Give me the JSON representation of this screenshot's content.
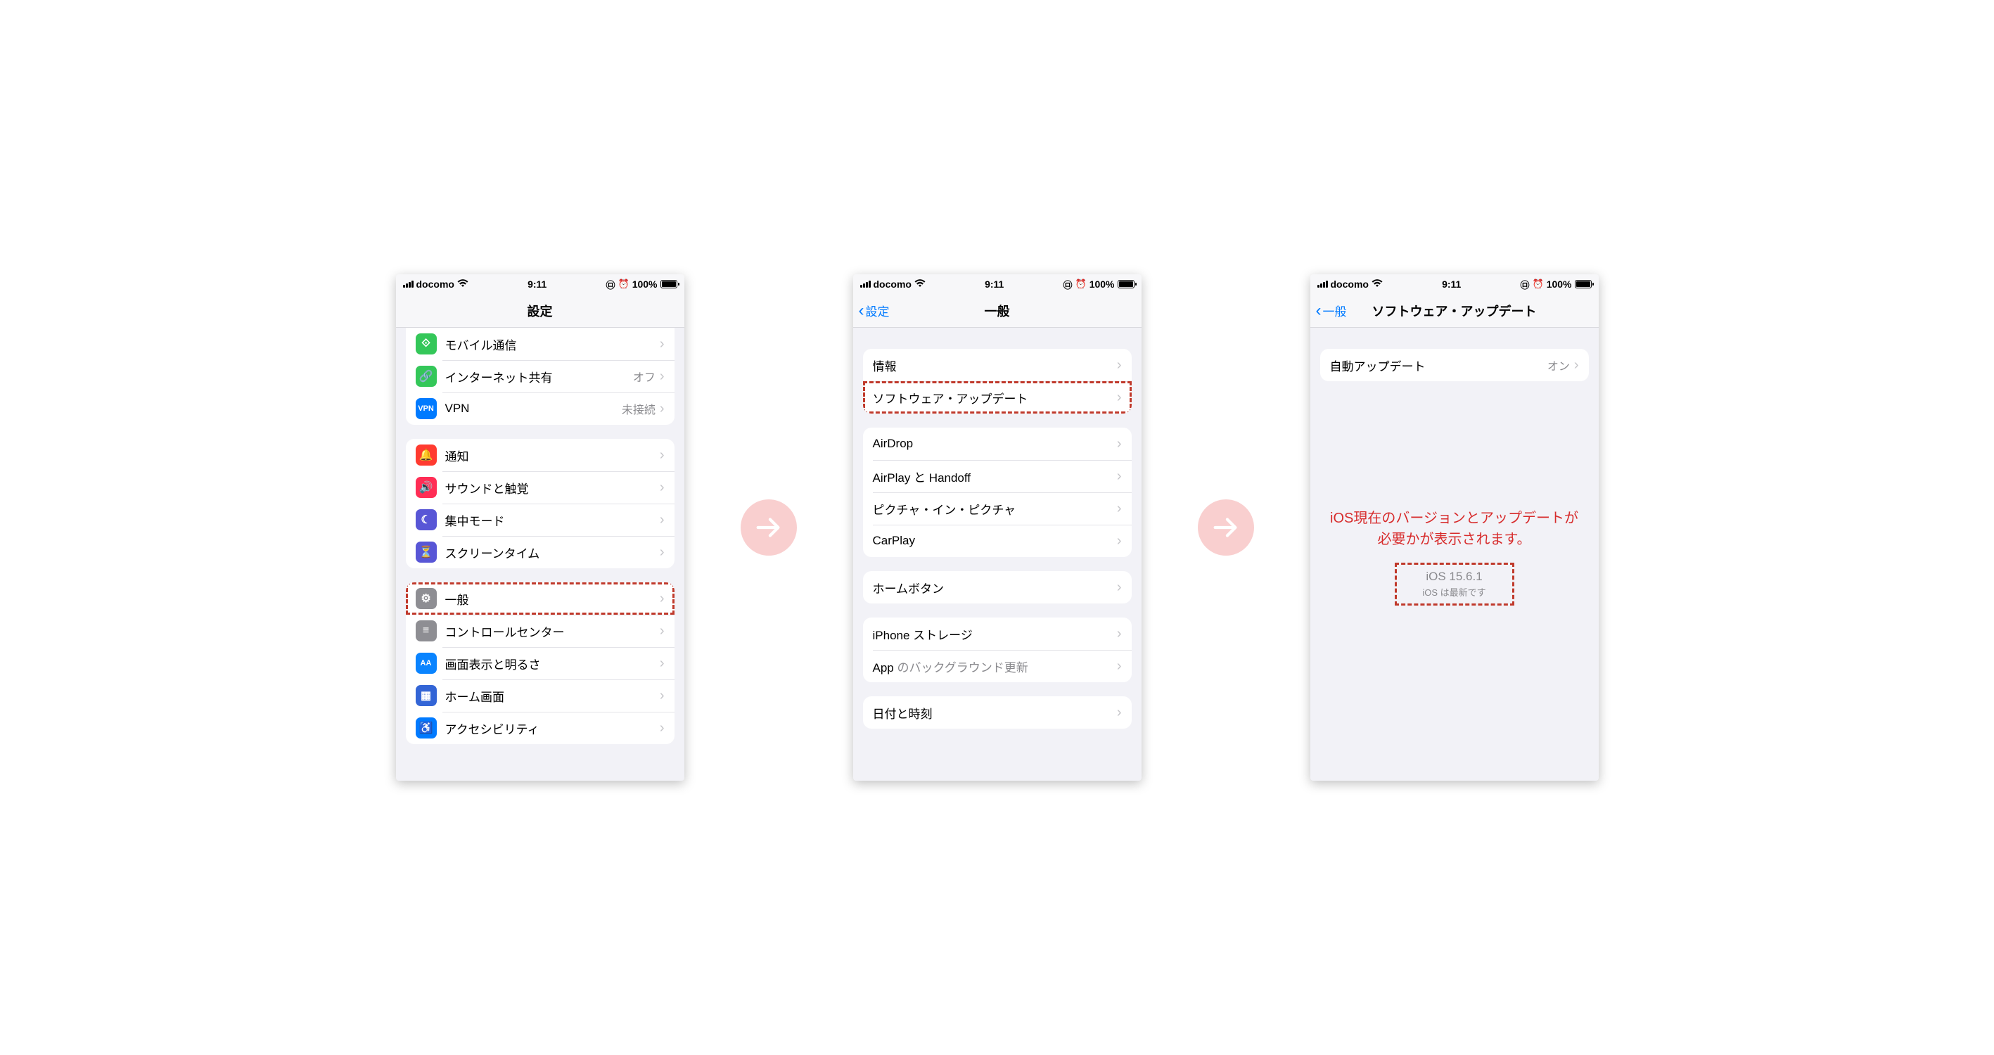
{
  "status": {
    "carrier": "docomo",
    "time": "9:11",
    "battery_pct": "100%"
  },
  "screen1": {
    "title": "設定",
    "rows_a": [
      {
        "label": "モバイル通信",
        "value": "",
        "icon": "antenna-icon",
        "bg": "bg-green"
      },
      {
        "label": "インターネット共有",
        "value": "オフ",
        "icon": "link-icon",
        "bg": "bg-green2"
      },
      {
        "label": "VPN",
        "value": "未接続",
        "icon": "vpn-icon",
        "bg": "bg-blue"
      }
    ],
    "rows_b": [
      {
        "label": "通知",
        "icon": "bell-icon",
        "bg": "bg-red"
      },
      {
        "label": "サウンドと触覚",
        "icon": "speaker-icon",
        "bg": "bg-pink"
      },
      {
        "label": "集中モード",
        "icon": "moon-icon",
        "bg": "bg-indigo"
      },
      {
        "label": "スクリーンタイム",
        "icon": "hourglass-icon",
        "bg": "bg-indigo"
      }
    ],
    "rows_c": [
      {
        "label": "一般",
        "icon": "gear-icon",
        "bg": "bg-gray",
        "highlight": true
      },
      {
        "label": "コントロールセンター",
        "icon": "switches-icon",
        "bg": "bg-gray"
      },
      {
        "label": "画面表示と明るさ",
        "icon": "aa-icon",
        "bg": "bg-bluea"
      },
      {
        "label": "ホーム画面",
        "icon": "grid-icon",
        "bg": "bg-home"
      },
      {
        "label": "アクセシビリティ",
        "icon": "accessibility-icon",
        "bg": "bg-access"
      }
    ]
  },
  "screen2": {
    "back": "設定",
    "title": "一般",
    "rows_a": [
      {
        "label": "情報"
      },
      {
        "label": "ソフトウェア・アップデート",
        "highlight": true
      }
    ],
    "rows_b": [
      {
        "label": "AirDrop"
      },
      {
        "label": "AirPlay と Handoff"
      },
      {
        "label": "ピクチャ・イン・ピクチャ"
      },
      {
        "label": "CarPlay"
      }
    ],
    "rows_c": [
      {
        "label": "ホームボタン"
      }
    ],
    "rows_d": [
      {
        "label": "iPhone ストレージ"
      },
      {
        "label_pre": "App",
        "label_dim": " のバックグラウンド更新"
      }
    ],
    "rows_e": [
      {
        "label": "日付と時刻"
      }
    ]
  },
  "screen3": {
    "back": "一般",
    "title": "ソフトウェア・アップデート",
    "row": {
      "label": "自動アップデート",
      "value": "オン"
    },
    "annotation": "iOS現在のバージョンとアップデートが必要かが表示されます。",
    "version": "iOS 15.6.1",
    "version_sub": "iOS は最新です"
  }
}
